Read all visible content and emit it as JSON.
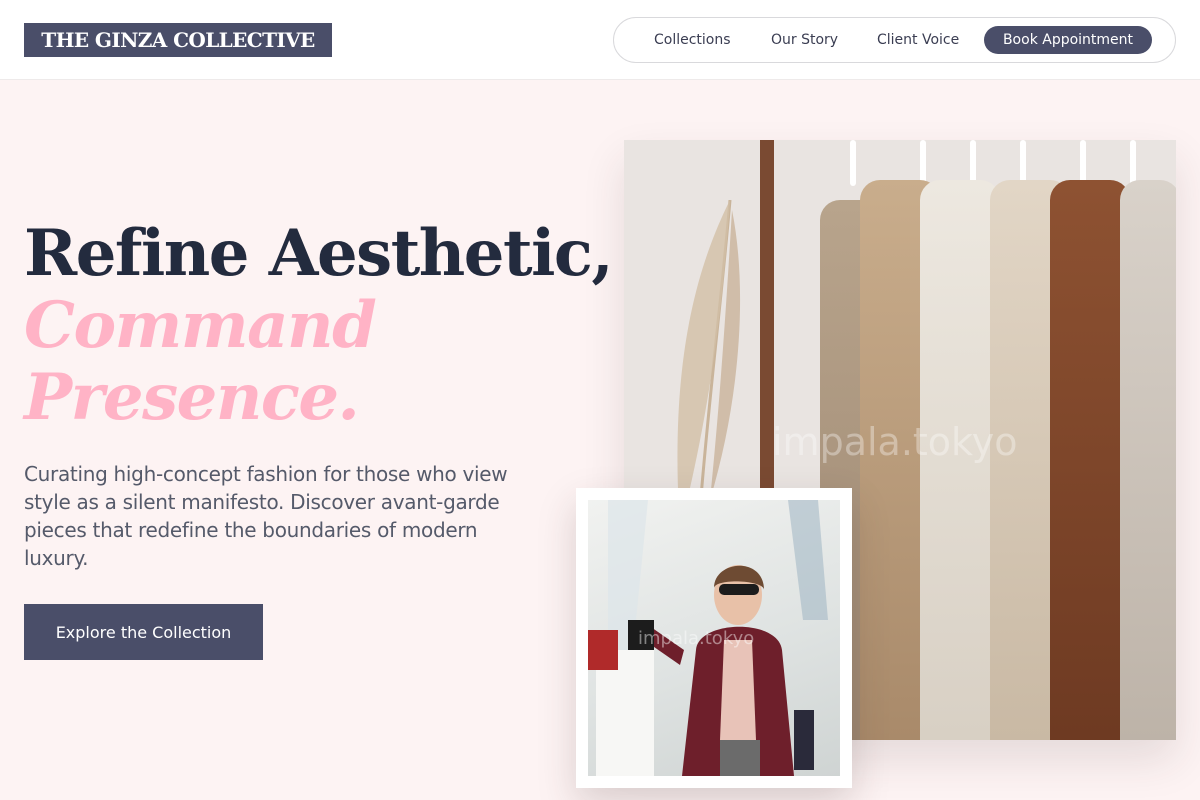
{
  "header": {
    "logo": "THE GINZA COLLECTIVE",
    "nav": [
      {
        "label": "Collections"
      },
      {
        "label": "Our Story"
      },
      {
        "label": "Client Voice"
      }
    ],
    "cta_label": "Book Appointment"
  },
  "hero": {
    "title_line1": "Refine Aesthetic,",
    "title_line2": "Command",
    "title_line3": "Presence.",
    "description": "Curating high-concept fashion for those who view style as a silent manifesto. Discover avant-garde pieces that redefine the boundaries of modern luxury.",
    "cta_label": "Explore the Collection"
  },
  "images": {
    "main_watermark": "impala.tokyo",
    "inset_watermark": "impala.tokyo"
  },
  "colors": {
    "brand": "#4a4e69",
    "accent_pink": "#ffb3c6",
    "background": "#fdf3f3",
    "heading": "#232b3e"
  }
}
